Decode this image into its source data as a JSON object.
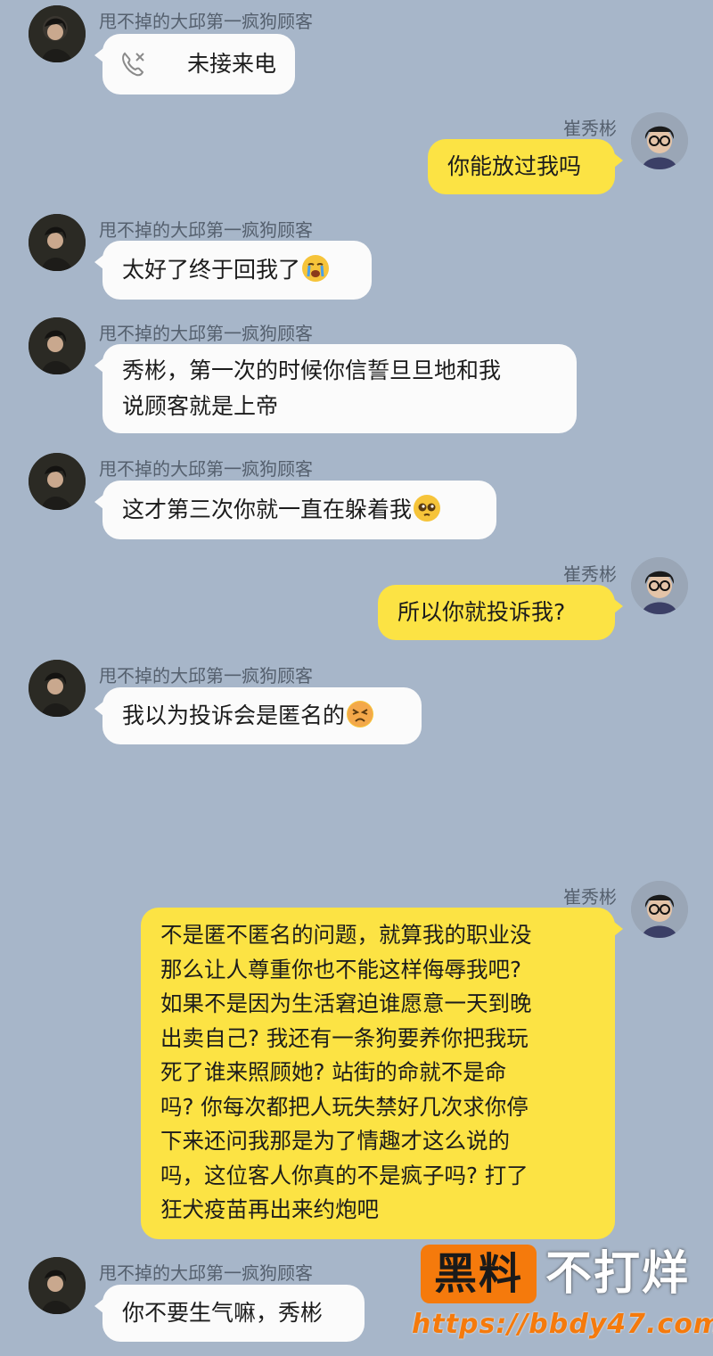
{
  "contacts": {
    "other_name": "甩不掉的大邱第一疯狗顾客",
    "self_name": "崔秀彬"
  },
  "messages": [
    {
      "type": "missed_call",
      "text": "未接来电"
    },
    {
      "type": "out",
      "text": "你能放过我吗"
    },
    {
      "type": "in",
      "text": "太好了终于回我了",
      "emoji": "loudly-crying-face"
    },
    {
      "type": "in",
      "lines": [
        "秀彬，第一次的时候你信誓旦旦地和我",
        "说顾客就是上帝"
      ]
    },
    {
      "type": "in",
      "text": "这才第三次你就一直在躲着我",
      "emoji": "pleading-face"
    },
    {
      "type": "out",
      "text": "所以你就投诉我?"
    },
    {
      "type": "in",
      "text": "我以为投诉会是匿名的",
      "emoji": "persevering-face"
    },
    {
      "type": "out",
      "lines": [
        "不是匿不匿名的问题，就算我的职业没",
        "那么让人尊重你也不能这样侮辱我吧?",
        "如果不是因为生活窘迫谁愿意一天到晚",
        "出卖自己? 我还有一条狗要养你把我玩",
        "死了谁来照顾她? 站街的命就不是命",
        "吗? 你每次都把人玩失禁好几次求你停",
        "下来还问我那是为了情趣才这么说的",
        "吗，这位客人你真的不是疯子吗? 打了",
        "狂犬疫苗再出来约炮吧"
      ]
    },
    {
      "type": "in",
      "text": "你不要生气嘛，秀彬"
    }
  ],
  "watermark": {
    "badge": "黑料",
    "text": "不打烊",
    "url": "https://bbdy47.com"
  },
  "colors": {
    "background": "#a7b6c9",
    "incoming_bubble": "#fbfbfb",
    "outgoing_bubble": "#fce344",
    "watermark_accent": "#f57a0c"
  }
}
